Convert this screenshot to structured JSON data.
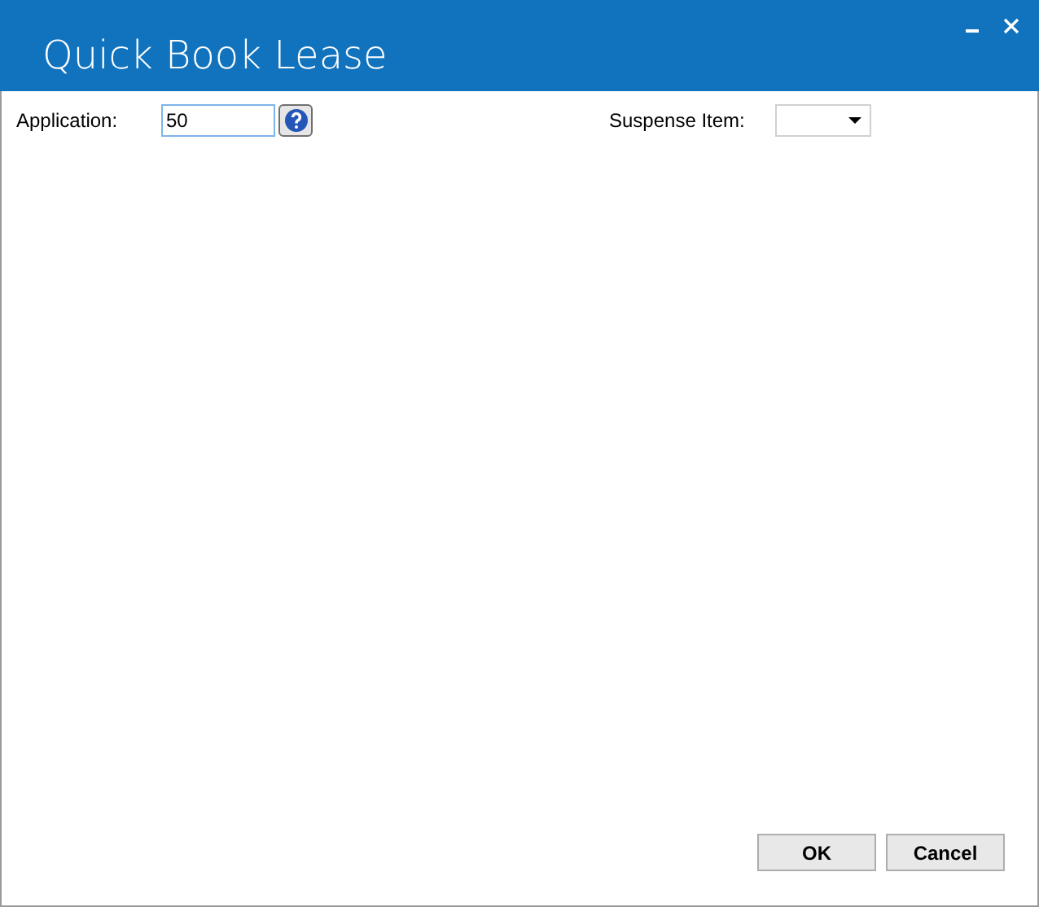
{
  "window": {
    "title": "Quick Book Lease"
  },
  "fields": [
    {
      "label": "Application:",
      "value": "50"
    },
    {
      "label": "Suspense Item:"
    }
  ],
  "buttons": [
    "OK",
    "Cancel"
  ]
}
